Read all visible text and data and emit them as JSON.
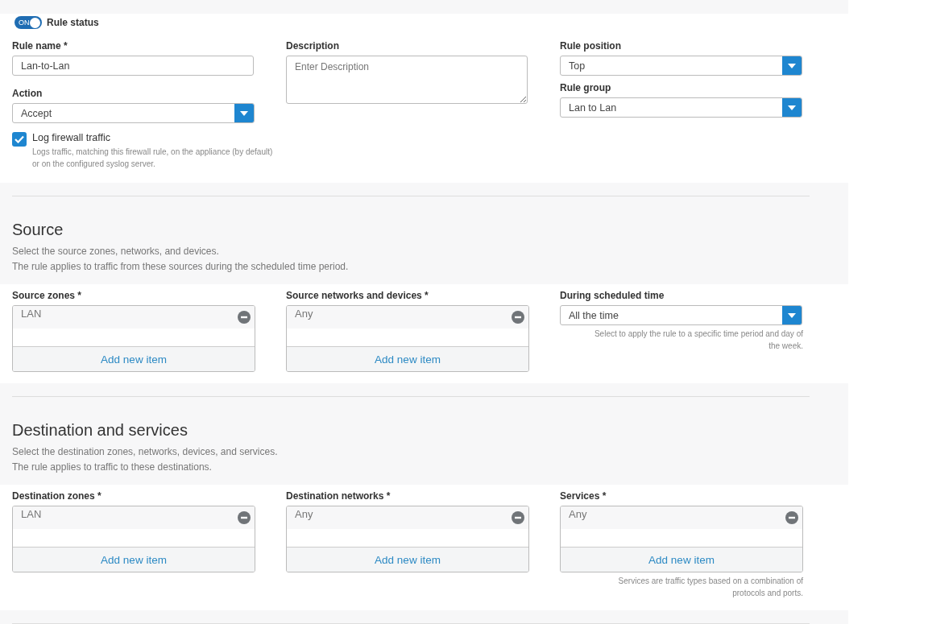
{
  "rule_status": {
    "toggle_text": "ON",
    "on": true,
    "label": "Rule status"
  },
  "general": {
    "rule_name": {
      "label": "Rule name *",
      "value": "Lan-to-Lan"
    },
    "action": {
      "label": "Action",
      "value": "Accept"
    },
    "log": {
      "label": "Log firewall traffic",
      "checked": true,
      "help": "Logs traffic, matching this firewall rule, on the appliance (by default) or on the configured syslog server."
    },
    "description": {
      "label": "Description",
      "placeholder": "Enter Description"
    },
    "rule_position": {
      "label": "Rule position",
      "value": "Top"
    },
    "rule_group": {
      "label": "Rule group",
      "value": "Lan to Lan"
    }
  },
  "sections": [
    {
      "title": "Source",
      "lines": [
        "Select the source zones, networks, and devices.",
        "The rule applies to traffic from these sources during the scheduled time period."
      ],
      "fields": [
        {
          "kind": "list",
          "label": "Source zones *",
          "items": [
            "LAN"
          ],
          "add_label": "Add new item"
        },
        {
          "kind": "list",
          "label": "Source networks and devices *",
          "items": [
            "Any"
          ],
          "add_label": "Add new item"
        },
        {
          "kind": "select",
          "label": "During scheduled time",
          "value": "All the time",
          "help": "Select to apply the rule to a specific time period and day of the week."
        }
      ]
    },
    {
      "title": "Destination and services",
      "lines": [
        "Select the destination zones, networks, devices, and services.",
        "The rule applies to traffic to these destinations."
      ],
      "fields": [
        {
          "kind": "list",
          "label": "Destination zones *",
          "items": [
            "LAN"
          ],
          "add_label": "Add new item"
        },
        {
          "kind": "list",
          "label": "Destination networks *",
          "items": [
            "Any"
          ],
          "add_label": "Add new item"
        },
        {
          "kind": "list",
          "label": "Services *",
          "items": [
            "Any"
          ],
          "add_label": "Add new item",
          "help": "Services are traffic types based on a combination of protocols and ports."
        }
      ]
    }
  ]
}
